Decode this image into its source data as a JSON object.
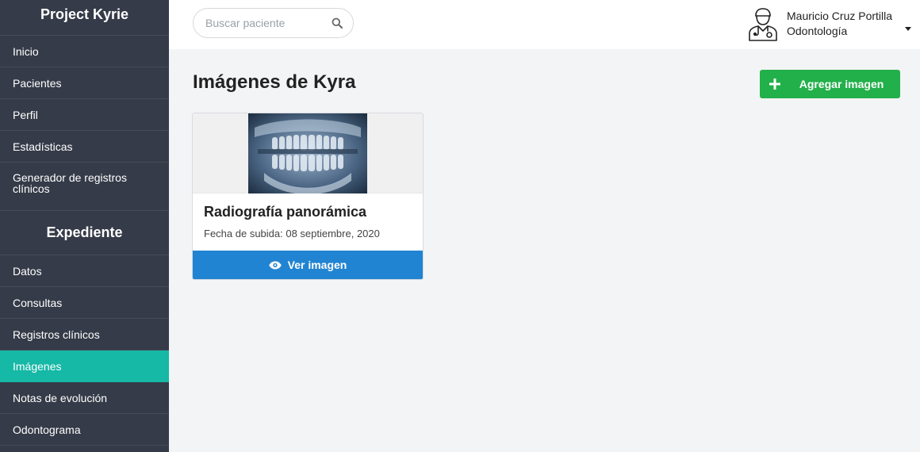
{
  "sidebar": {
    "title": "Project Kyrie",
    "items": [
      {
        "label": "Inicio"
      },
      {
        "label": "Pacientes"
      },
      {
        "label": "Perfil"
      },
      {
        "label": "Estadísticas"
      },
      {
        "label": "Generador de registros clínicos"
      }
    ],
    "section_title": "Expediente",
    "section_items": [
      {
        "label": "Datos"
      },
      {
        "label": "Consultas"
      },
      {
        "label": "Registros clínicos"
      },
      {
        "label": "Imágenes"
      },
      {
        "label": "Notas de evolución"
      },
      {
        "label": "Odontograma"
      }
    ],
    "active_color": "#16b8a6",
    "background_color": "#353b48"
  },
  "header": {
    "search_placeholder": "Buscar paciente",
    "search_icon": "search-icon",
    "user": {
      "name": "Mauricio Cruz Portilla",
      "role": "Odontología",
      "avatar_icon": "doctor-avatar-icon"
    }
  },
  "main": {
    "title": "Imágenes de Kyra",
    "add_button_label": "Agregar imagen",
    "add_button_color": "#22b04a",
    "cards": [
      {
        "title": "Radiografía panorámica",
        "date": "Fecha de subida: 08 septiembre, 2020",
        "view_label": "Ver imagen",
        "view_icon": "eye-icon",
        "view_color": "#2184d2"
      }
    ]
  }
}
